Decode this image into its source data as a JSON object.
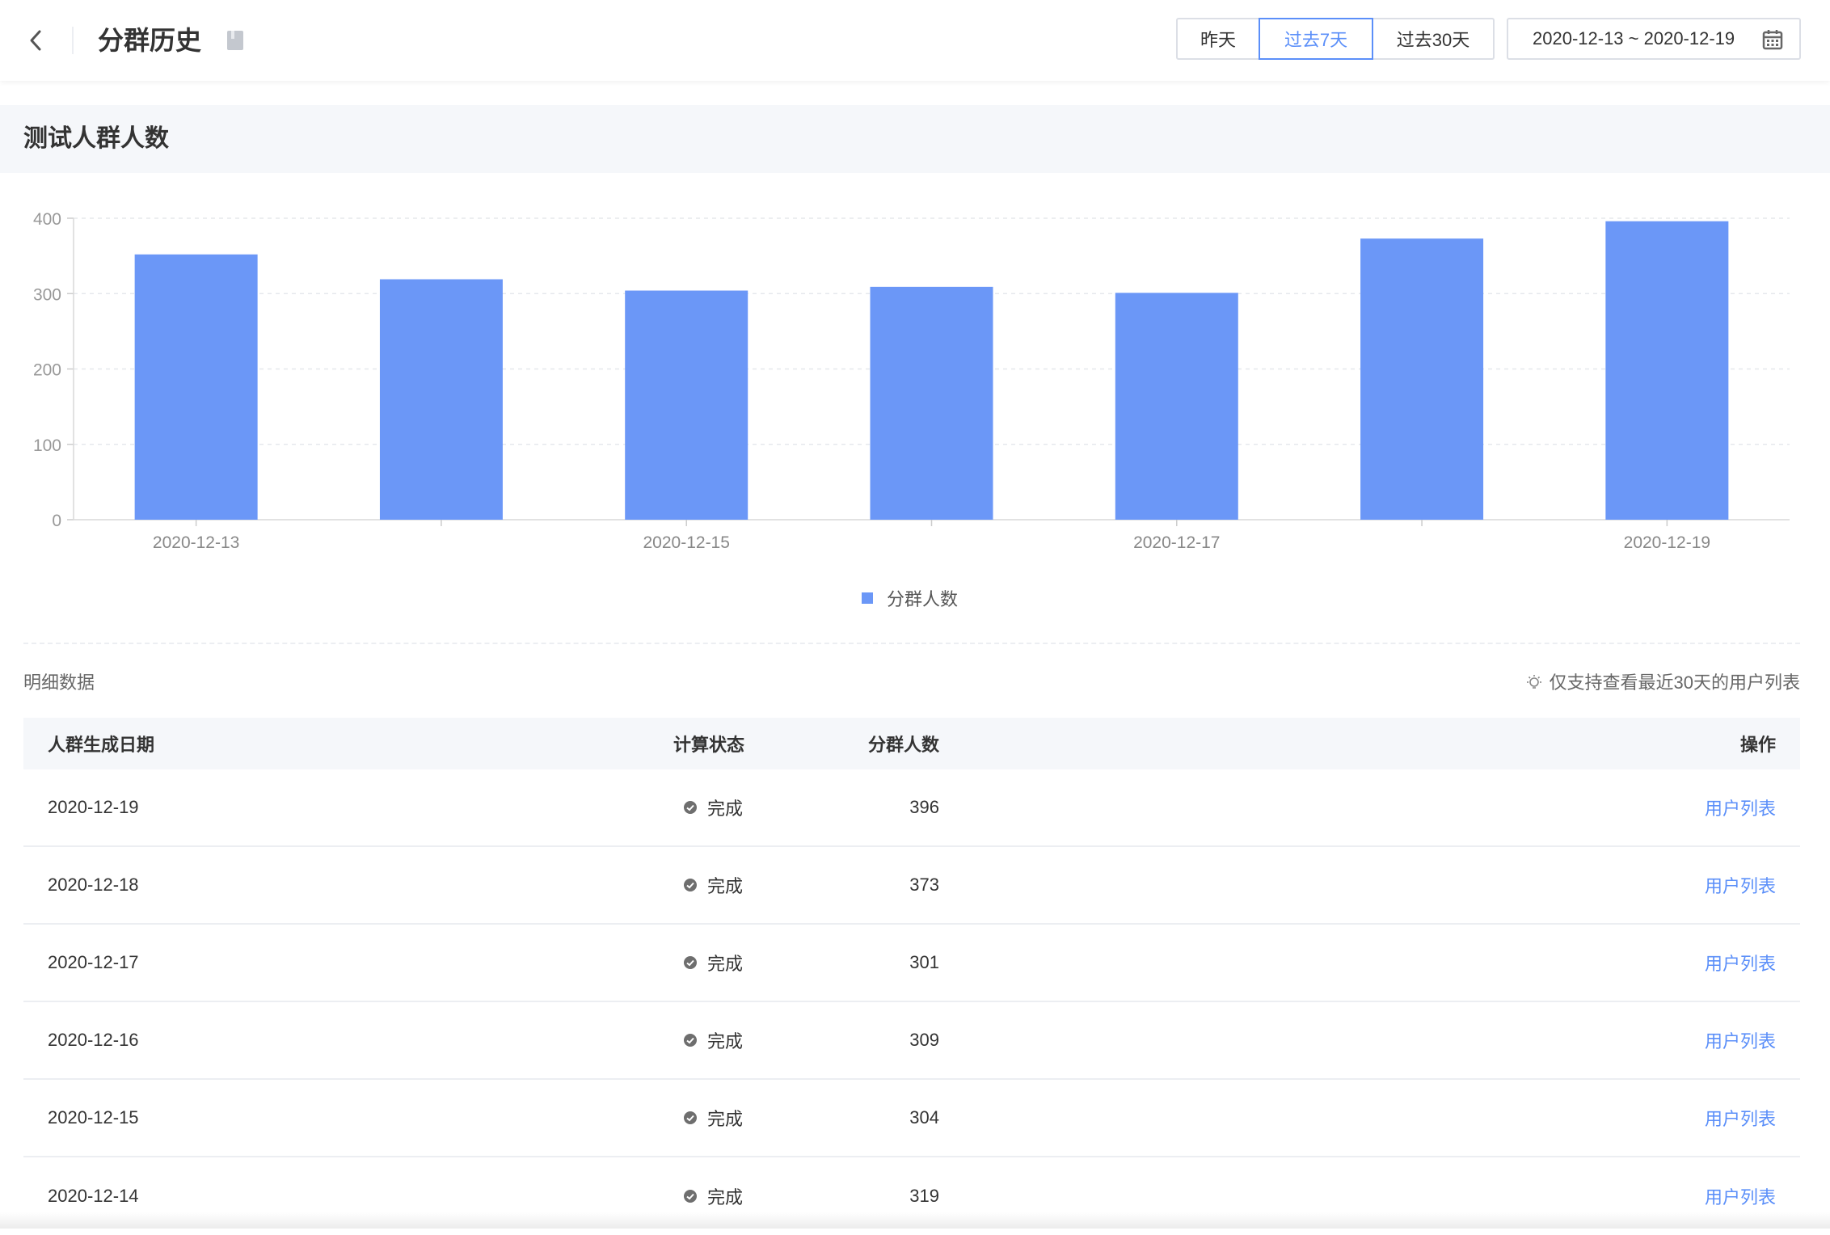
{
  "header": {
    "title": "分群历史",
    "range_buttons": [
      "昨天",
      "过去7天",
      "过去30天"
    ],
    "active_range": "过去7天",
    "date_range": "2020-12-13 ~ 2020-12-19"
  },
  "section": {
    "title": "测试人群人数"
  },
  "chart_data": {
    "type": "bar",
    "categories": [
      "2020-12-13",
      "2020-12-14",
      "2020-12-15",
      "2020-12-16",
      "2020-12-17",
      "2020-12-18",
      "2020-12-19"
    ],
    "x_tick_labels": [
      "2020-12-13",
      "",
      "2020-12-15",
      "",
      "2020-12-17",
      "",
      "2020-12-19"
    ],
    "series": [
      {
        "name": "分群人数",
        "values": [
          352,
          319,
          304,
          309,
          301,
          373,
          396
        ]
      }
    ],
    "y_ticks": [
      0,
      100,
      200,
      300,
      400
    ],
    "ylim": [
      0,
      400
    ],
    "grid": true,
    "legend": "bottom-center",
    "color": "#6b97f7"
  },
  "details": {
    "label": "明细数据",
    "hint": "仅支持查看最近30天的用户列表",
    "columns": {
      "date": "人群生成日期",
      "count": "分群人数",
      "status": "计算状态",
      "op": "操作"
    },
    "rows": [
      {
        "date": "2020-12-19",
        "count": "396",
        "status": "完成",
        "op": "用户列表"
      },
      {
        "date": "2020-12-18",
        "count": "373",
        "status": "完成",
        "op": "用户列表"
      },
      {
        "date": "2020-12-17",
        "count": "301",
        "status": "完成",
        "op": "用户列表"
      },
      {
        "date": "2020-12-16",
        "count": "309",
        "status": "完成",
        "op": "用户列表"
      },
      {
        "date": "2020-12-15",
        "count": "304",
        "status": "完成",
        "op": "用户列表"
      },
      {
        "date": "2020-12-14",
        "count": "319",
        "status": "完成",
        "op": "用户列表"
      }
    ]
  },
  "colors": {
    "accent": "#5b8ff9",
    "bar": "#6b97f7",
    "status_done": "#666666"
  }
}
